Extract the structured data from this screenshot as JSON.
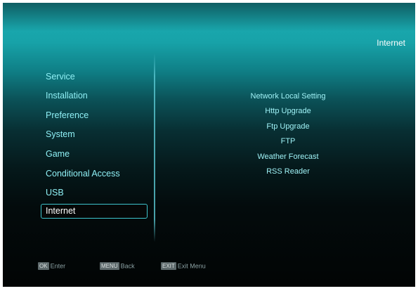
{
  "header": {
    "title": "Internet"
  },
  "main_menu": {
    "items": [
      {
        "label": "Service"
      },
      {
        "label": "Installation"
      },
      {
        "label": "Preference"
      },
      {
        "label": "System"
      },
      {
        "label": "Game"
      },
      {
        "label": "Conditional Access"
      },
      {
        "label": "USB"
      },
      {
        "label": "Internet"
      }
    ],
    "selected": "Internet"
  },
  "submenu": {
    "items": [
      {
        "label": "Network Local Setting"
      },
      {
        "label": "Http Upgrade"
      },
      {
        "label": "Ftp Upgrade"
      },
      {
        "label": "FTP"
      },
      {
        "label": "Weather Forecast"
      },
      {
        "label": "RSS Reader"
      }
    ]
  },
  "footer": {
    "ok_key": "OK",
    "ok_label": "Enter",
    "menu_key": "MENU",
    "menu_label": "Back",
    "exit_key": "EXIT",
    "exit_label": "Exit Menu"
  },
  "colors": {
    "accent": "#19a6ac",
    "text": "#8ff0f5",
    "selection_border": "#3ec4cc"
  }
}
